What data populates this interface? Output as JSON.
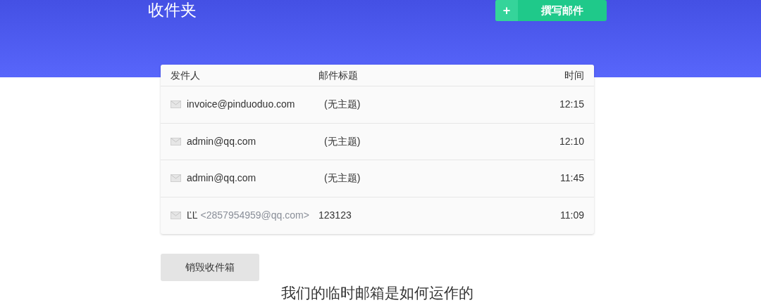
{
  "header": {
    "title": "收件夹",
    "compose_button": {
      "icon_label": "+",
      "label": "撰写邮件"
    }
  },
  "table": {
    "columns": [
      "发件人",
      "邮件标题",
      "时间"
    ],
    "rows": [
      {
        "sender": "invoice@pinduoduo.com",
        "subject": "(无主题)",
        "time": "12:15"
      },
      {
        "sender": "admin@qq.com",
        "subject": "(无主题)",
        "time": "12:10"
      },
      {
        "sender": "admin@qq.com",
        "subject": "(无主题)",
        "time": "11:45"
      },
      {
        "sender": "ĽĽ",
        "sender_address": "<2857954959@qq.com>",
        "subject": "123123",
        "time": "11:09"
      }
    ]
  },
  "destroy_button": "销毁收件箱",
  "section_heading": "我们的临时邮箱是如何运作的"
}
